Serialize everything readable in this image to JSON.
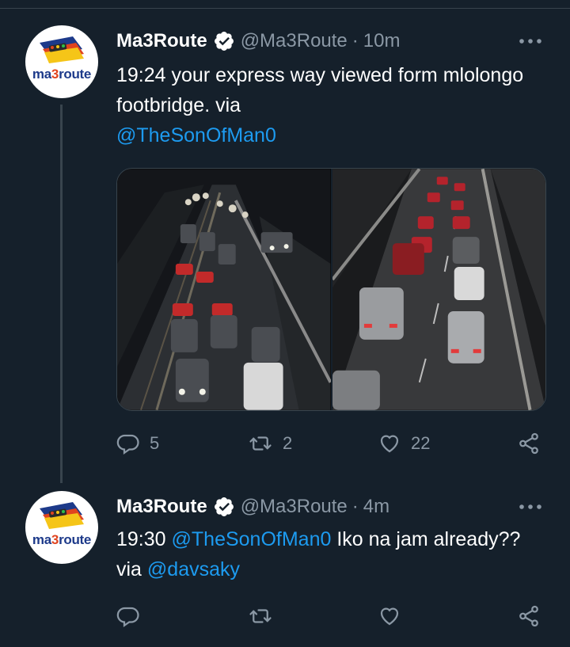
{
  "tweets": [
    {
      "author": {
        "name": "Ma3Route",
        "handle": "@Ma3Route",
        "avatar_text": "ma3route"
      },
      "time": "10m",
      "separator": "·",
      "text": {
        "time": "19:24",
        "body": "your express way viewed form mlolongo footbridge.   via",
        "mention": "@TheSonOfMan0"
      },
      "media": [
        {
          "alt": "Night traffic jam on expressway, wide view"
        },
        {
          "alt": "Night traffic jam on expressway, close view"
        }
      ],
      "actions": {
        "replies": "5",
        "retweets": "2",
        "likes": "22"
      }
    },
    {
      "author": {
        "name": "Ma3Route",
        "handle": "@Ma3Route",
        "avatar_text": "ma3route"
      },
      "time": "4m",
      "separator": "·",
      "text": {
        "time": "19:30",
        "mention1": "@TheSonOfMan0",
        "middle": "Iko na jam already?? via",
        "mention2": "@davsaky"
      },
      "actions": {
        "replies": "",
        "retweets": "",
        "likes": ""
      }
    }
  ],
  "icons": {
    "verified": "verified-badge-icon",
    "more": "more-options-icon",
    "reply": "reply-icon",
    "retweet": "retweet-icon",
    "like": "heart-icon",
    "share": "share-icon"
  },
  "colors": {
    "background": "#15202b",
    "text_secondary": "#8b98a5",
    "link": "#1d9bf0",
    "divider": "#38444d"
  }
}
